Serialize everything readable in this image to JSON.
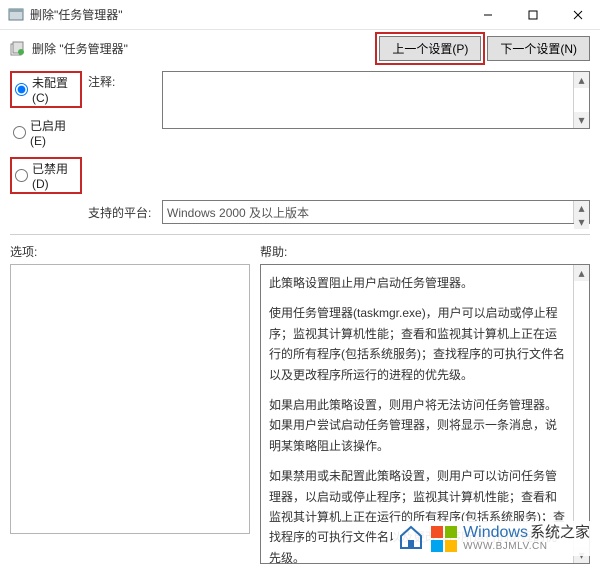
{
  "window": {
    "title": "删除\"任务管理器\""
  },
  "header": {
    "subtitle": "删除  \"任务管理器\"",
    "prev_button": "上一个设置(P)",
    "next_button": "下一个设置(N)"
  },
  "radios": {
    "not_configured": "未配置(C)",
    "enabled": "已启用(E)",
    "disabled": "已禁用(D)",
    "selected": "not_configured"
  },
  "labels": {
    "comment": "注释:",
    "platform": "支持的平台:",
    "options": "选项:",
    "help": "帮助:"
  },
  "platform_value": "Windows 2000 及以上版本",
  "help_paragraphs": [
    "此策略设置阻止用户启动任务管理器。",
    "使用任务管理器(taskmgr.exe)，用户可以启动或停止程序；监视其计算机性能；查看和监视其计算机上正在运行的所有程序(包括系统服务)；查找程序的可执行文件名以及更改程序所运行的进程的优先级。",
    "如果启用此策略设置，则用户将无法访问任务管理器。如果用户尝试启动任务管理器，则将显示一条消息，说明某策略阻止该操作。",
    "如果禁用或未配置此策略设置，则用户可以访问任务管理器，以启动或停止程序；监视其计算机性能；查看和监视其计算机上正在运行的所有程序(包括系统服务)；查找程序的可执行文件名以及更改程序所运行的进程的优先级。"
  ],
  "watermark": {
    "brand1": "Windows",
    "brand2": "系统之家",
    "url": "WWW.BJMLV.CN"
  }
}
